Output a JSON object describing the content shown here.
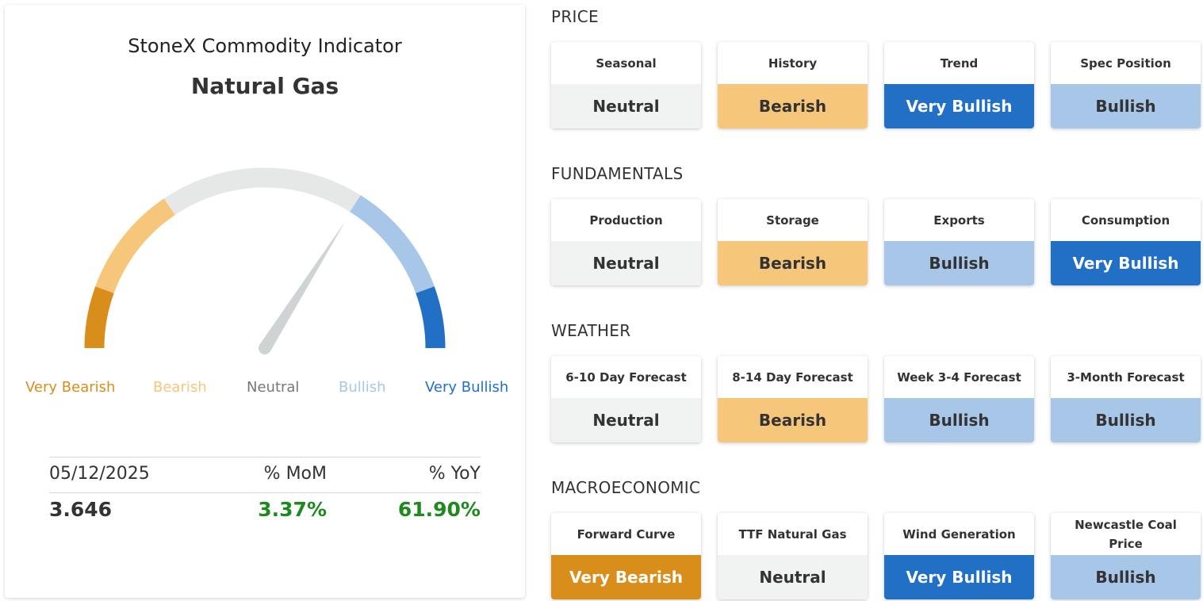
{
  "indicator": {
    "title": "StoneX Commodity Indicator",
    "commodity": "Natural Gas",
    "gauge_value_fraction": 0.68,
    "gauge_labels": [
      {
        "text": "Very Bearish",
        "color": "#d98e1c"
      },
      {
        "text": "Bearish",
        "color": "#f6c67a"
      },
      {
        "text": "Neutral",
        "color": "#777777"
      },
      {
        "text": "Bullish",
        "color": "#a7c6e8"
      },
      {
        "text": "Very Bullish",
        "color": "#2270c6"
      }
    ],
    "stats": {
      "date": "05/12/2025",
      "mom_label": "% MoM",
      "yoy_label": "% YoY",
      "price": "3.646",
      "mom_value": "3.37%",
      "yoy_value": "61.90%",
      "positive_color": "#1e8a1e"
    }
  },
  "sections": [
    {
      "title": "PRICE",
      "cards": [
        {
          "label": "Seasonal",
          "status": "Neutral",
          "style": "neutral"
        },
        {
          "label": "History",
          "status": "Bearish",
          "style": "bearish"
        },
        {
          "label": "Trend",
          "status": "Very Bullish",
          "style": "vbullish"
        },
        {
          "label": "Spec Position",
          "status": "Bullish",
          "style": "bullish"
        }
      ]
    },
    {
      "title": "FUNDAMENTALS",
      "cards": [
        {
          "label": "Production",
          "status": "Neutral",
          "style": "neutral"
        },
        {
          "label": "Storage",
          "status": "Bearish",
          "style": "bearish"
        },
        {
          "label": "Exports",
          "status": "Bullish",
          "style": "bullish"
        },
        {
          "label": "Consumption",
          "status": "Very Bullish",
          "style": "vbullish"
        }
      ]
    },
    {
      "title": "WEATHER",
      "cards": [
        {
          "label": "6-10 Day Forecast",
          "status": "Neutral",
          "style": "neutral"
        },
        {
          "label": "8-14 Day Forecast",
          "status": "Bearish",
          "style": "bearish"
        },
        {
          "label": "Week 3-4 Forecast",
          "status": "Bullish",
          "style": "bullish"
        },
        {
          "label": "3-Month Forecast",
          "status": "Bullish",
          "style": "bullish"
        }
      ]
    },
    {
      "title": "MACROECONOMIC",
      "cards": [
        {
          "label": "Forward Curve",
          "status": "Very Bearish",
          "style": "vbearish"
        },
        {
          "label": "TTF Natural Gas",
          "status": "Neutral",
          "style": "neutral"
        },
        {
          "label": "Wind Generation",
          "status": "Very Bullish",
          "style": "vbullish"
        },
        {
          "label": "Newcastle Coal Price",
          "status": "Bullish",
          "style": "bullish"
        }
      ]
    }
  ]
}
